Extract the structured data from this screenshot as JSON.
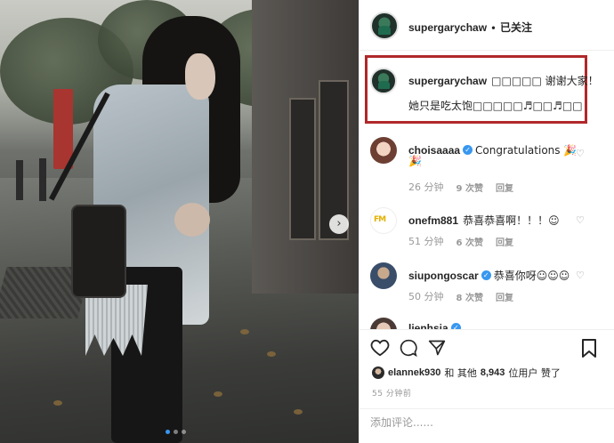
{
  "header": {
    "username": "supergarychaw",
    "separator": "•",
    "follow_status": "已关注"
  },
  "comments": [
    {
      "username": "supergarychaw",
      "text": "□□□□□ 谢谢大家！",
      "text2": "她只是吃太饱□□□□□♬□□♬□□",
      "highlighted": true
    },
    {
      "username": "choisaaaa",
      "verified": true,
      "text": "Congratulations 🎉",
      "text2": "🎉",
      "time": "26 分钟",
      "likes": "9 次赞",
      "reply": "回复"
    },
    {
      "username": "onefm881",
      "verified": false,
      "text": "恭喜恭喜啊！！！☺",
      "time": "51 分钟",
      "likes": "6 次赞",
      "reply": "回复"
    },
    {
      "username": "siupongoscar",
      "verified": true,
      "text": "恭喜你呀☺☺☺",
      "time": "50 分钟",
      "likes": "8 次赞",
      "reply": "回复"
    },
    {
      "username": "lienhsia",
      "verified": true,
      "text": ""
    }
  ],
  "actions": {
    "like_icon": "heart-outline-icon",
    "comment_icon": "speech-bubble-icon",
    "share_icon": "paper-plane-icon",
    "save_icon": "bookmark-icon"
  },
  "likes_summary": {
    "first_liker": "elannek930",
    "connector": "和 其他",
    "count": "8,943",
    "suffix": "位用户 赞了"
  },
  "post_time": "55 分钟前",
  "add_comment_placeholder": "添加评论......",
  "colors": {
    "highlight_border": "#b0282a",
    "verified_blue": "#3897f0",
    "meta_gray": "#999999"
  }
}
